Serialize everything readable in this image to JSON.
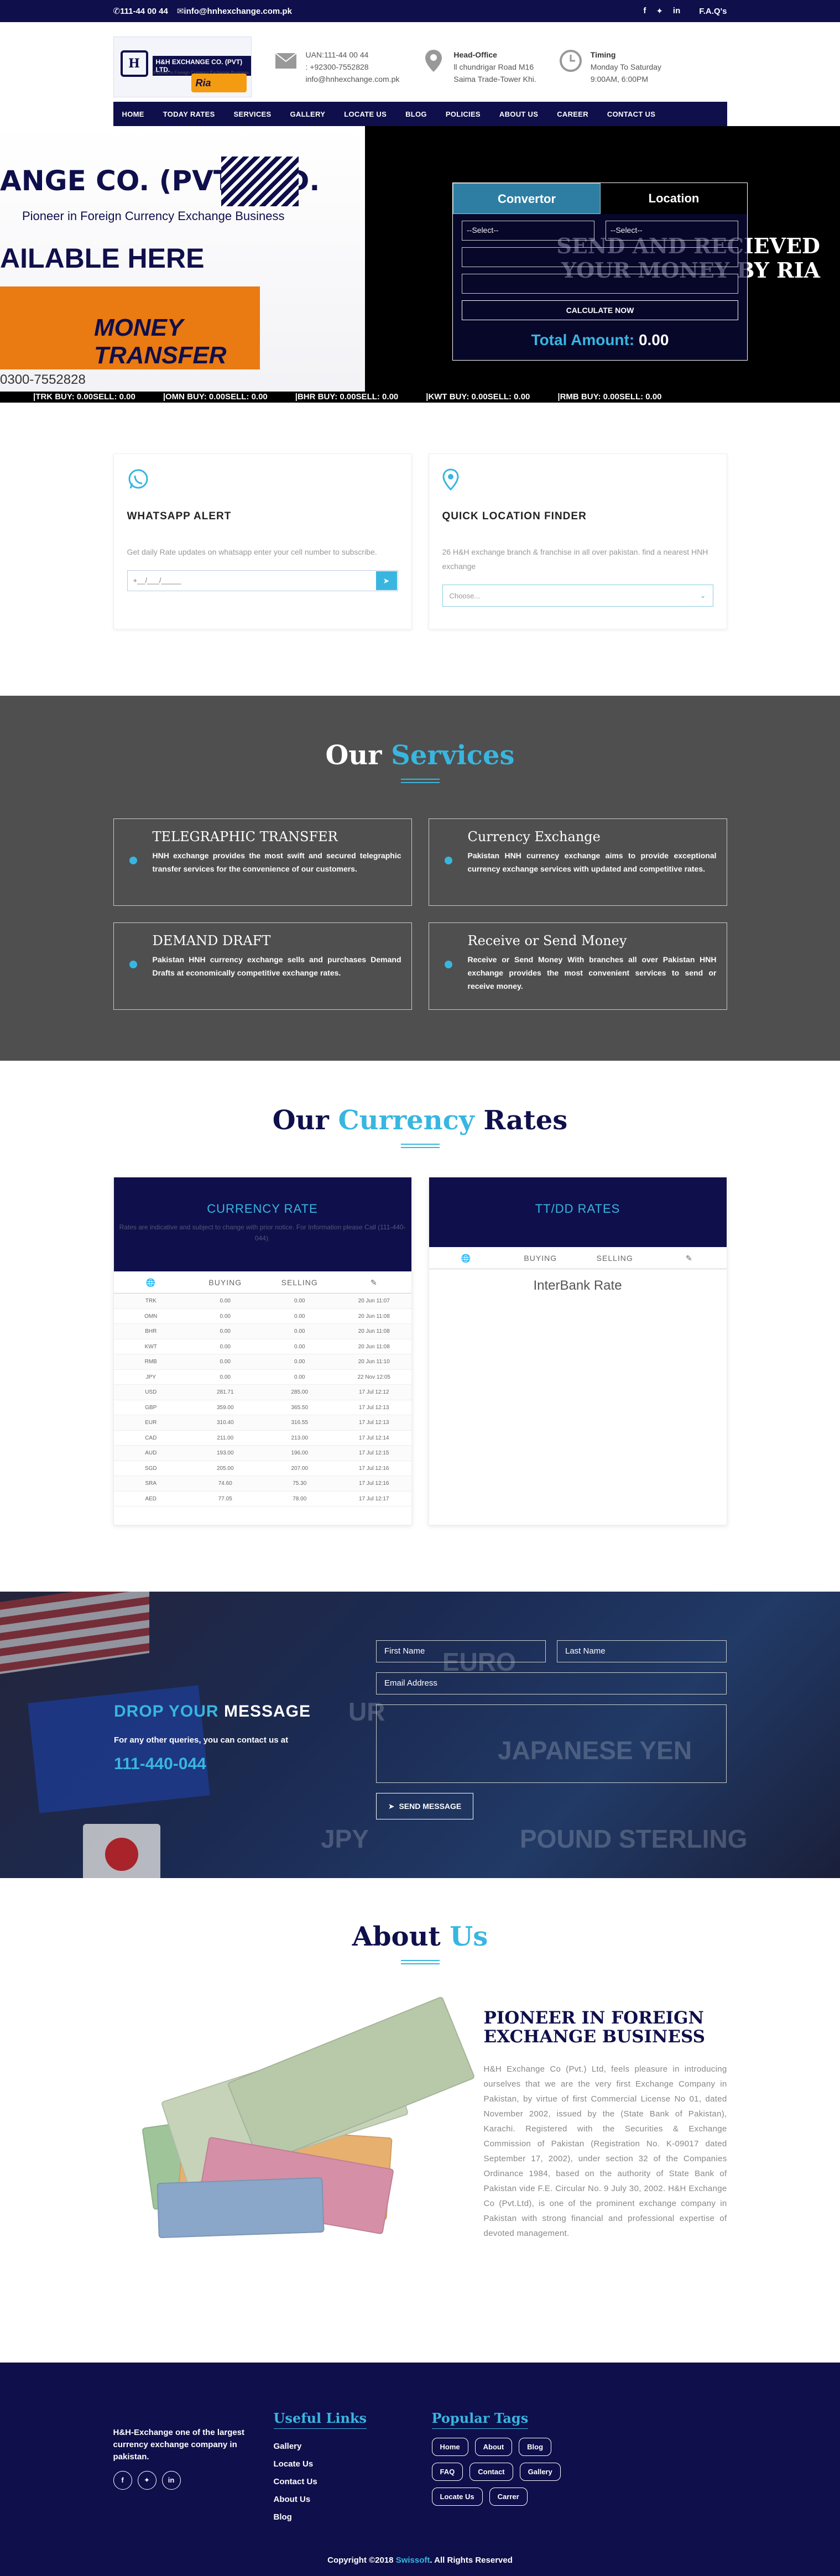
{
  "topbar": {
    "phone": "111-44 00 44",
    "email": "info@hnhexchange.com.pk",
    "faq": "F.A.Q's"
  },
  "logo": {
    "name": "H&H EXCHANGE CO. (PVT) LTD.",
    "tagline": "Pioneer in Foreign Currency Exchange Business",
    "ria": "Ria"
  },
  "header": {
    "phone": {
      "line1": "UAN:111-44 00 44",
      "line2": ": +92300-7552828",
      "line3": "info@hnhexchange.com.pk"
    },
    "office": {
      "title": "Head-Office",
      "line1": "ll chundrigar Road M16",
      "line2": "Saima Trade-Tower Khi."
    },
    "timing": {
      "title": "Timing",
      "line1": "Monday To Saturday",
      "line2": "9:00AM, 6:00PM"
    }
  },
  "nav": [
    "HOME",
    "TODAY RATES",
    "SERVICES",
    "GALLERY",
    "LOCATE US",
    "BLOG",
    "POLICIES",
    "ABOUT US",
    "CAREER",
    "CONTACT US"
  ],
  "hero": {
    "banner_title": "ANGE CO. (PVT) LTD.",
    "banner_sub": "Pioneer in Foreign Currency Exchange Business",
    "banner_avail": "AILABLE HERE",
    "banner_ria": "MONEY TRANSFER",
    "banner_phone": "0300-7552828",
    "tagline_line1": "SEND AND RECIEVED",
    "tagline_line2": "YOUR MONEY BY RIA",
    "tab_convertor": "Convertor",
    "tab_location": "Location",
    "select_placeholder": "--Select--",
    "select2_placeholder": "--Select--",
    "calculate": "CALCULATE NOW",
    "total_label": "Total Amount:",
    "total_value": "0.00",
    "ticker": [
      "|TRK BUY: 0.00SELL: 0.00",
      "|OMN BUY: 0.00SELL: 0.00",
      "|BHR BUY: 0.00SELL: 0.00",
      "|KWT BUY: 0.00SELL: 0.00",
      "|RMB BUY: 0.00SELL: 0.00"
    ]
  },
  "alerts": {
    "whatsapp": {
      "title": "WHATSAPP ALERT",
      "text": "Get daily Rate updates on whatsapp enter your cell number to subscribe.",
      "placeholder": "+__/___/_____"
    },
    "location": {
      "title": "QUICK LOCATION FINDER",
      "text": "26 H&H exchange branch & franchise in all over pakistan. find a nearest HNH exchange",
      "placeholder": "Choose..."
    }
  },
  "services": {
    "title_a": "Our",
    "title_b": "Services",
    "items": [
      {
        "title": "TELEGRAPHIC TRANSFER",
        "text": "HNH exchange provides the most swift and secured telegraphic transfer services for the convenience of our customers."
      },
      {
        "title": "Currency Exchange",
        "text": "Pakistan HNH currency exchange aims to provide exceptional currency exchange services with updated and competitive rates."
      },
      {
        "title": "DEMAND DRAFT",
        "text": "Pakistan HNH currency exchange sells and purchases Demand Drafts at economically competitive exchange rates."
      },
      {
        "title": "Receive or Send Money",
        "text": "Receive or Send Money With branches all over Pakistan HNH exchange provides the most convenient services to send or receive money."
      }
    ]
  },
  "rates": {
    "title_a": "Our",
    "title_b": "Currency",
    "title_c": "Rates",
    "currency_title": "CURRENCY RATE",
    "currency_note": "Rates are indicative and subject to change with prior notice. For Information please Call (111-440-044).",
    "tt_title": "TT/DD RATES",
    "col_buy": "BUYING",
    "col_sell": "SELLING",
    "interbank": "InterBank Rate",
    "rows": [
      [
        "TRK",
        "0.00",
        "0.00",
        "20 Jun 11:07"
      ],
      [
        "OMN",
        "0.00",
        "0.00",
        "20 Jun 11:08"
      ],
      [
        "BHR",
        "0.00",
        "0.00",
        "20 Jun 11:08"
      ],
      [
        "KWT",
        "0.00",
        "0.00",
        "20 Jun 11:08"
      ],
      [
        "RMB",
        "0.00",
        "0.00",
        "20 Jun 11:10"
      ],
      [
        "JPY",
        "0.00",
        "0.00",
        "22 Nov 12:05"
      ],
      [
        "USD",
        "281.71",
        "285.00",
        "17 Jul 12:12"
      ],
      [
        "GBP",
        "359.00",
        "365.50",
        "17 Jul 12:13"
      ],
      [
        "EUR",
        "310.40",
        "316.55",
        "17 Jul 12:13"
      ],
      [
        "CAD",
        "211.00",
        "213.00",
        "17 Jul 12:14"
      ],
      [
        "AUD",
        "193.00",
        "196.00",
        "17 Jul 12:15"
      ],
      [
        "SGD",
        "205.00",
        "207.00",
        "17 Jul 12:16"
      ],
      [
        "SRA",
        "74.60",
        "75.30",
        "17 Jul 12:16"
      ],
      [
        "AED",
        "77.05",
        "78.00",
        "17 Jul 12:17"
      ]
    ]
  },
  "message": {
    "title_a": "DROP YOUR",
    "title_b": "MESSAGE",
    "text": "For any other queries, you can contact us at",
    "phone": "111-440-044",
    "first_name": "First Name",
    "last_name": "Last Name",
    "email": "Email Address",
    "send": "SEND MESSAGE",
    "bg_euro": "EURO",
    "bg_yen": "JAPANESE YEN",
    "bg_sterling": "POUND STERLING",
    "bg_jpy": "JPY",
    "bg_ur": "UR"
  },
  "about": {
    "title_a": "About",
    "title_b": "Us",
    "heading": "PIONEER IN FOREIGN EXCHANGE BUSINESS",
    "text": "H&H Exchange Co (Pvt.) Ltd, feels pleasure in introducing ourselves that we are the very first Exchange Company in Pakistan, by virtue of first Commercial License No 01, dated November 2002, issued by the (State Bank of Pakistan), Karachi. Registered with the Securities & Exchange Commission of Pakistan (Registration No. K-09017 dated September 17, 2002), under section 32 of the Companies Ordinance 1984, based on the authority of State Bank of Pakistan vide F.E. Circular No. 9 July 30, 2002. H&H Exchange Co (Pvt.Ltd), is one of the prominent exchange company in Pakistan with strong financial and professional expertise of devoted management."
  },
  "footer": {
    "about": "H&H-Exchange one of the largest currency exchange company in pakistan.",
    "links_title": "Useful Links",
    "links": [
      "Gallery",
      "Locate Us",
      "Contact Us",
      "About Us",
      "Blog"
    ],
    "tags_title": "Popular Tags",
    "tags": [
      "Home",
      "About",
      "Blog",
      "FAQ",
      "Contact",
      "Gallery",
      "Locate Us",
      "Carrer"
    ],
    "copyright_a": "Copyright ©2018",
    "copyright_b": "Swissoft",
    "copyright_c": ". All Rights Reserved"
  },
  "colors": {
    "navy": "#0f0f4b",
    "accent": "#38b6e0",
    "services_bg": "#4f4f4f"
  }
}
